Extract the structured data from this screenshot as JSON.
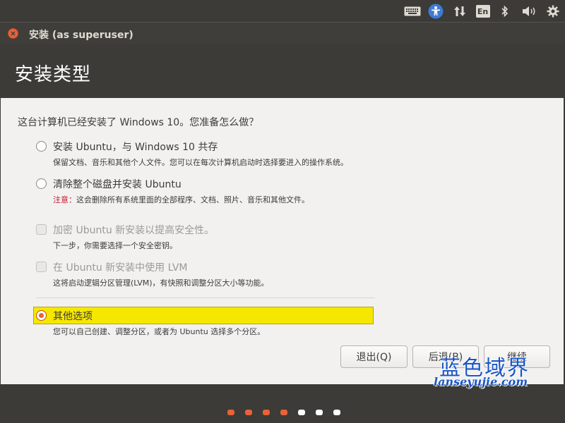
{
  "top_panel": {
    "icons": [
      "keyboard-icon",
      "accessibility-icon",
      "network-icon",
      "keyboard-layout-icon",
      "bluetooth-icon",
      "volume-icon",
      "settings-gear-icon"
    ],
    "keyboard_layout_label": "En"
  },
  "window": {
    "title": "安装 (as superuser)"
  },
  "header": {
    "title": "安装类型"
  },
  "main": {
    "question": "这台计算机已经安装了 Windows 10。您准备怎么做？",
    "options": [
      {
        "label": "安装 Ubuntu，与 Windows 10 共存",
        "description": "保留文档、音乐和其他个人文件。您可以在每次计算机启动时选择要进入的操作系统。",
        "type": "radio",
        "selected": false
      },
      {
        "label": "清除整个磁盘并安装 Ubuntu",
        "note_prefix": "注意：",
        "description": "这会删除所有系统里面的全部程序、文档、照片、音乐和其他文件。",
        "type": "radio",
        "selected": false
      },
      {
        "label": "加密 Ubuntu 新安装以提高安全性。",
        "description": "下一步，你需要选择一个安全密钥。",
        "type": "checkbox",
        "disabled": true
      },
      {
        "label": "在 Ubuntu 新安装中使用 LVM",
        "description": "这将启动逻辑分区管理(LVM)，有快照和调整分区大小等功能。",
        "type": "checkbox",
        "disabled": true
      },
      {
        "label": "其他选项",
        "description": "您可以自己创建、调整分区，或者为 Ubuntu 选择多个分区。",
        "type": "radio",
        "selected": true,
        "highlight_color": "#f6e700"
      }
    ]
  },
  "buttons": {
    "quit": "退出(Q)",
    "back": "后退(B)",
    "continue": "继续"
  },
  "progress": {
    "total_steps": 7,
    "completed_steps": 4,
    "active_color": "#e8623a",
    "inactive_color": "#ffffff"
  },
  "watermark": {
    "text": "蓝色域界",
    "url": "lanseyujie.com"
  },
  "colors": {
    "accent": "#e8623a",
    "panel": "#3c3b37",
    "content_bg": "#f2f1f0",
    "warning": "#c7162b"
  }
}
